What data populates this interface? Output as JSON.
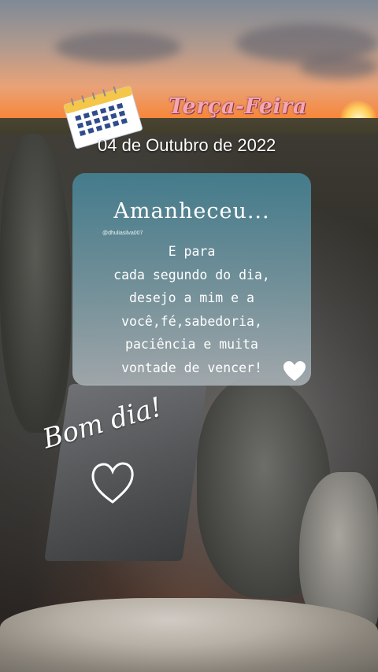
{
  "header": {
    "weekday": "Terça-Feira",
    "date": "04 de Outubro de 2022"
  },
  "card": {
    "title": "Amanheceu...",
    "handle": "@dhuliasilva007",
    "message": "E para\ncada segundo do dia,\ndesejo a mim e a\nvocê,fé,sabedoria,\npaciência e muita\nvontade de vencer!"
  },
  "overlay": {
    "greeting": "Bom dia!"
  },
  "colors": {
    "weekday_text": "#f3a6b3",
    "card_top": "#448092",
    "card_bottom": "#aab2b6",
    "sunset_orange": "#f7873a"
  },
  "icons": [
    "calendar-icon",
    "heart-icon",
    "heart-outline-icon"
  ]
}
